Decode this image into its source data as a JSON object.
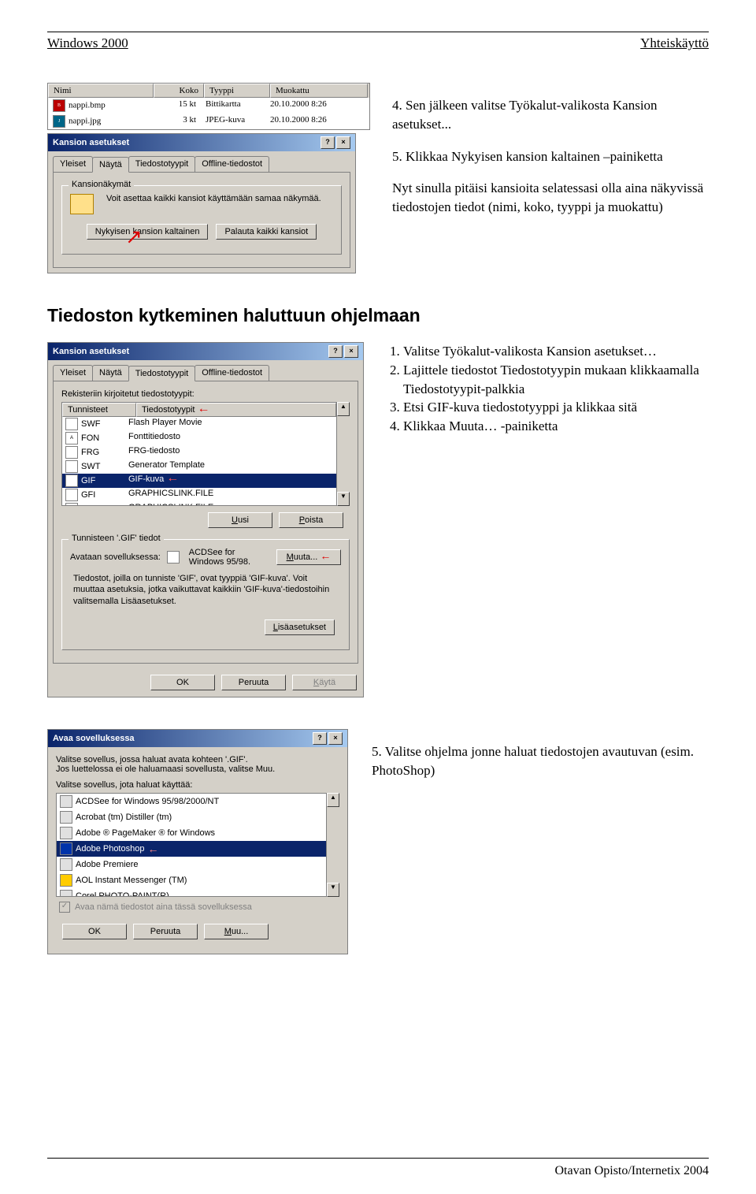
{
  "header": {
    "left": "Windows 2000",
    "right": "Yhteiskäyttö"
  },
  "fileList": {
    "cols": [
      "Nimi",
      "Koko",
      "Tyyppi",
      "Muokattu"
    ],
    "rows": [
      {
        "icon": "BMP",
        "name": "nappi.bmp",
        "size": "15 kt",
        "type": "Bittikartta",
        "date": "20.10.2000 8:26"
      },
      {
        "icon": "JPG",
        "name": "nappi.jpg",
        "size": "3 kt",
        "type": "JPEG-kuva",
        "date": "20.10.2000 8:26"
      }
    ]
  },
  "dlg1": {
    "title": "Kansion asetukset",
    "tabs": [
      "Yleiset",
      "Näytä",
      "Tiedostotyypit",
      "Offline-tiedostot"
    ],
    "groupTitle": "Kansionäkymät",
    "groupText": "Voit asettaa kaikki kansiot käyttämään samaa näkymää.",
    "btn1": "Nykyisen kansion kaltainen",
    "btn2": "Palauta kaikki kansiot"
  },
  "instr1": {
    "p1": "4. Sen jälkeen valitse Työkalut-valikosta Kansion asetukset...",
    "p2": "5. Klikkaa Nykyisen kansion kaltainen –painiketta",
    "p3": "Nyt sinulla pitäisi kansioita selatessasi olla aina näkyvissä tiedostojen tiedot (nimi, koko, tyyppi ja muokattu)"
  },
  "heading2": "Tiedoston kytkeminen haluttuun ohjelmaan",
  "dlg2": {
    "title": "Kansion asetukset",
    "tabs": [
      "Yleiset",
      "Näytä",
      "Tiedostotyypit",
      "Offline-tiedostot"
    ],
    "label1": "Rekisteriin kirjoitetut tiedostotyypit:",
    "cols": [
      "Tunnisteet",
      "Tiedostotyypit"
    ],
    "rows": [
      {
        "ext": "SWF",
        "type": "Flash Player Movie"
      },
      {
        "ext": "FON",
        "type": "Fonttitiedosto"
      },
      {
        "ext": "FRG",
        "type": "FRG-tiedosto"
      },
      {
        "ext": "SWT",
        "type": "Generator Template"
      },
      {
        "ext": "GIF",
        "type": "GIF-kuva",
        "selected": true
      },
      {
        "ext": "GFI",
        "type": "GRAPHICSLINK.FILE"
      },
      {
        "ext": "GFX",
        "type": "GRAPHICSLINK.FILE"
      }
    ],
    "btnNew": "Uusi",
    "btnDel": "Poista",
    "groupTitle": "Tunnisteen '.GIF' tiedot",
    "openLabel": "Avataan sovelluksessa:",
    "openApp": "ACDSee for Windows 95/98.",
    "btnChange": "Muuta...",
    "infoText": "Tiedostot, joilla on tunniste 'GIF', ovat tyyppiä 'GIF-kuva'. Voit muuttaa asetuksia, jotka vaikuttavat kaikkiin 'GIF-kuva'-tiedostoihin valitsemalla Lisäasetukset.",
    "btnAdv": "Lisäasetukset",
    "btnOk": "OK",
    "btnCancel": "Peruuta",
    "btnApply": "Käytä"
  },
  "instr2": {
    "i1": "1. Valitse Työkalut-valikosta Kansion asetukset…",
    "i2": "2. Lajittele tiedostot Tiedostotyypin mukaan klikkaamalla Tiedostotyypit-palkkia",
    "i3": "3. Etsi GIF-kuva tiedostotyyppi ja klikkaa sitä",
    "i4": "4. Klikkaa Muuta… -painiketta"
  },
  "dlg3": {
    "title": "Avaa sovelluksessa",
    "text1": "Valitse sovellus, jossa haluat avata kohteen '.GIF'.",
    "text2": "Jos luettelossa ei ole haluamaasi sovellusta, valitse Muu.",
    "label": "Valitse sovellus, jota haluat käyttää:",
    "apps": [
      {
        "name": "ACDSee for Windows 95/98/2000/NT"
      },
      {
        "name": "Acrobat (tm) Distiller (tm)"
      },
      {
        "name": "Adobe ® PageMaker ® for Windows"
      },
      {
        "name": "Adobe Photoshop",
        "selected": true
      },
      {
        "name": "Adobe Premiere"
      },
      {
        "name": "AOL Instant Messenger (TM)"
      },
      {
        "name": "Corel PHOTO-PAINT(R)"
      }
    ],
    "chkLabel": "Avaa nämä tiedostot aina tässä sovelluksessa",
    "btnOk": "OK",
    "btnCancel": "Peruuta",
    "btnOther": "Muu..."
  },
  "instr3": {
    "i5": "5. Valitse ohjelma jonne haluat tiedostojen avautuvan (esim. PhotoShop)"
  },
  "footer": "Otavan Opisto/Internetix 2004"
}
